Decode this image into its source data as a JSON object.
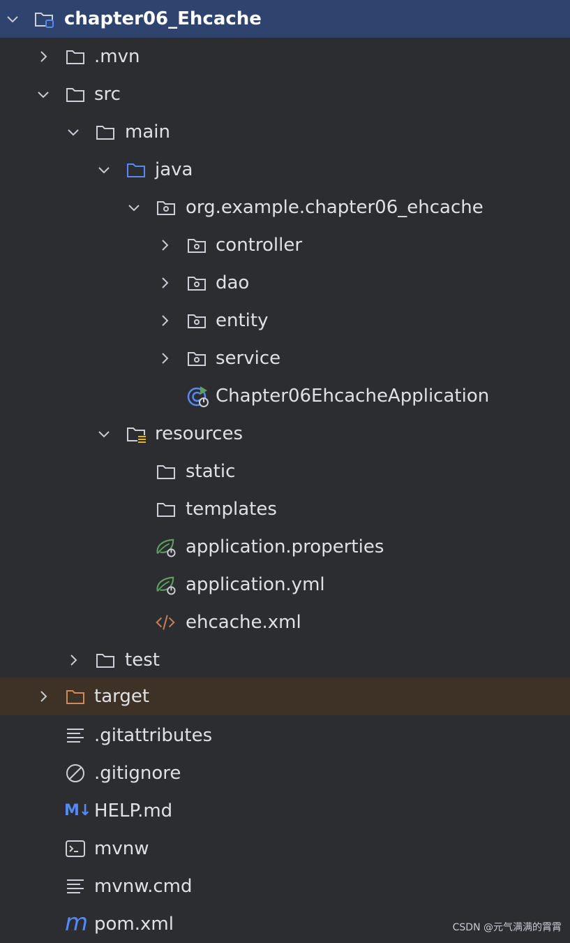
{
  "project_tree": {
    "root": {
      "label": "chapter06_Ehcache",
      "expanded": true
    },
    "items": [
      {
        "label": ".mvn",
        "icon": "folder-icon",
        "expanded": false
      },
      {
        "label": "src",
        "icon": "folder-icon",
        "expanded": true
      },
      {
        "label": "main",
        "icon": "folder-icon",
        "expanded": true
      },
      {
        "label": "java",
        "icon": "source-folder-icon",
        "expanded": true
      },
      {
        "label": "org.example.chapter06_ehcache",
        "icon": "package-icon",
        "expanded": true
      },
      {
        "label": "controller",
        "icon": "package-icon",
        "expanded": false
      },
      {
        "label": "dao",
        "icon": "package-icon",
        "expanded": false
      },
      {
        "label": "entity",
        "icon": "package-icon",
        "expanded": false
      },
      {
        "label": "service",
        "icon": "package-icon",
        "expanded": false
      },
      {
        "label": "Chapter06EhcacheApplication",
        "icon": "spring-boot-app-icon"
      },
      {
        "label": "resources",
        "icon": "resources-folder-icon",
        "expanded": true
      },
      {
        "label": "static",
        "icon": "folder-icon"
      },
      {
        "label": "templates",
        "icon": "folder-icon"
      },
      {
        "label": "application.properties",
        "icon": "spring-config-icon"
      },
      {
        "label": "application.yml",
        "icon": "spring-config-icon"
      },
      {
        "label": "ehcache.xml",
        "icon": "xml-icon"
      },
      {
        "label": "test",
        "icon": "folder-icon",
        "expanded": false
      },
      {
        "label": "target",
        "icon": "excluded-folder-icon",
        "expanded": false
      },
      {
        "label": ".gitattributes",
        "icon": "text-file-icon"
      },
      {
        "label": ".gitignore",
        "icon": "ignore-file-icon"
      },
      {
        "label": "HELP.md",
        "icon": "markdown-icon"
      },
      {
        "label": "mvnw",
        "icon": "shell-script-icon"
      },
      {
        "label": "mvnw.cmd",
        "icon": "text-file-icon"
      },
      {
        "label": "pom.xml",
        "icon": "maven-icon"
      }
    ]
  },
  "watermark": "CSDN @元气满满的霄霄",
  "colors": {
    "background": "#2b2d30",
    "selected_root": "#2e436e",
    "excluded_row": "#3e3226",
    "text": "#dfe1e5",
    "accent_blue": "#548af7",
    "spring_green": "#5fa05f",
    "xml_orange": "#c77d55"
  }
}
